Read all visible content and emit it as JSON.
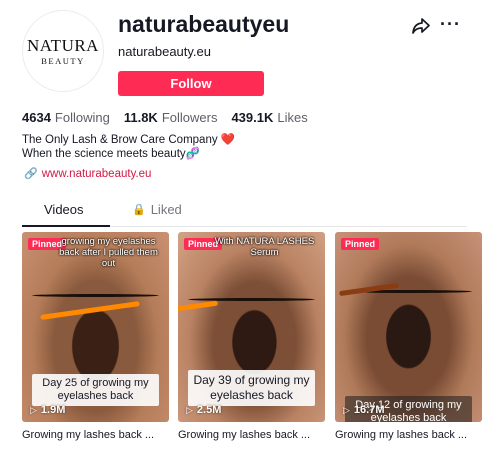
{
  "profile": {
    "avatar_text_top": "NATURA",
    "avatar_text_bottom": "BEAUTY",
    "username": "naturabeautyeu",
    "nickname": "naturabeauty.eu",
    "follow_label": "Follow",
    "share_icon": "share-icon",
    "more_icon": "more-icon",
    "more_glyph": "···"
  },
  "stats": {
    "following_value": "4634",
    "following_label": "Following",
    "followers_value": "11.8K",
    "followers_label": "Followers",
    "likes_value": "439.1K",
    "likes_label": "Likes"
  },
  "bio": {
    "line1": "The Only Lash & Brow Care Company",
    "line2": "When the science meets beauty",
    "heart_glyph": "❤️",
    "dna_glyph": "🧬"
  },
  "website": {
    "link_glyph": "🔗",
    "url": "www.naturabeauty.eu"
  },
  "tabs": {
    "videos": "Videos",
    "liked": "Liked",
    "lock_glyph": "🔒"
  },
  "videos": [
    {
      "pinned": "Pinned",
      "overlay_top": "growing my eyelashes back after I pulled them out",
      "caption": "Day 25 of growing my eyelashes back",
      "views": "1.9M",
      "title": "Growing my lashes back ..."
    },
    {
      "pinned": "Pinned",
      "overlay_top": "With NATURA LASHES Serum",
      "caption": "Day 39 of growing my eyelashes back",
      "views": "2.5M",
      "title": "Growing my lashes back ..."
    },
    {
      "pinned": "Pinned",
      "overlay_top": "",
      "caption": "Day 12 of growing my eyelashes back",
      "views": "16.7M",
      "title": "Growing my lashes back ..."
    }
  ],
  "play_glyph": "▷",
  "colors": {
    "accent": "#fe2c55",
    "link": "#d11a43",
    "text": "#161823",
    "muted": "#5d5f68"
  }
}
